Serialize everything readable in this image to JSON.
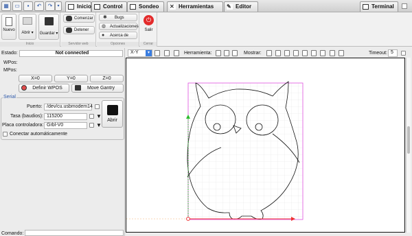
{
  "tabs": [
    {
      "label": "Inicio",
      "name": "tab-inicio"
    },
    {
      "label": "Control",
      "name": "tab-control"
    },
    {
      "label": "Sondeo",
      "name": "tab-sondeo"
    },
    {
      "label": "Herramientas",
      "name": "tab-herramientas"
    },
    {
      "label": "Editor",
      "name": "tab-editor"
    },
    {
      "label": "Terminal",
      "name": "tab-terminal"
    }
  ],
  "ribbon": {
    "nuevo": "Nuevo",
    "abrir": "Abrir",
    "guardar": "Guardar",
    "comenzar": "Comenzar",
    "detener": "Detener",
    "bugs": "Bugs",
    "actualizaciones": "Actualizaciones",
    "acerca": "Acerca de",
    "salir": "Salir",
    "group_inicio": "Inicio",
    "group_servidor": "Servidor web",
    "group_opciones": "Opciones",
    "group_cerrar": "Cerrar"
  },
  "status": {
    "estado_label": "Estado:",
    "estado_value": "Not connected",
    "wpos_label": "WPos:",
    "mpos_label": "MPos:"
  },
  "zero": {
    "x": "X=0",
    "y": "Y=0",
    "z": "Z=0"
  },
  "actions": {
    "definir": "Definir WPOS",
    "move": "Move Gantry"
  },
  "serial": {
    "title": "Serial",
    "puerto_label": "Puerto:",
    "puerto_value": "/dev/cu.usbmodem14",
    "tasa_label": "Tasa (baudios):",
    "tasa_value": "115200",
    "placa_label": "Placa controladora:",
    "placa_value": "Grbl-V0",
    "abrir": "Abrir",
    "auto_label": "Conectar automáticamente"
  },
  "toolbar": {
    "view_value": "X-Y",
    "herramienta_label": "Herramienta:",
    "mostrar_label": "Mostrar:",
    "timeout_label": "Timeout:",
    "timeout_value": "5"
  },
  "comando_label": "Comando:",
  "colors": {
    "margin": "#e050e0",
    "xaxis": "#ee3030",
    "yaxis": "#2bbb2b",
    "grid": "#e4e4e4"
  }
}
